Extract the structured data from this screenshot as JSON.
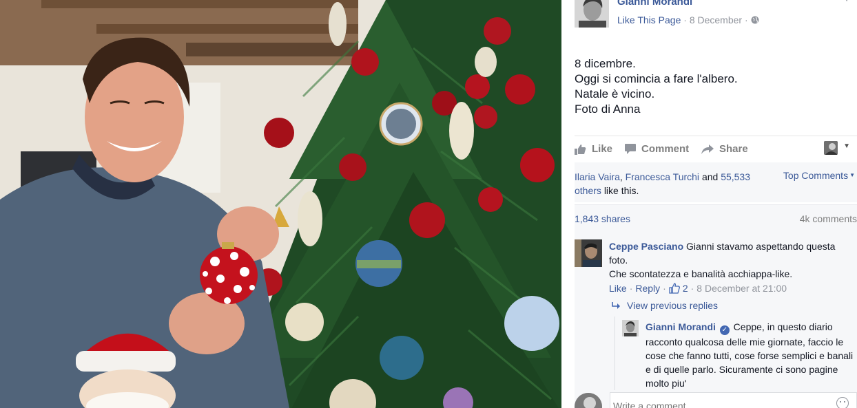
{
  "post": {
    "page_name": "Gianni Morandi",
    "like_page": "Like This Page",
    "separator": "·",
    "date": "8 December",
    "lines": [
      "8 dicembre.",
      "Oggi si comincia a fare l'albero.",
      "Natale è vicino.",
      "Foto di Anna"
    ]
  },
  "actions": {
    "like": "Like",
    "comment": "Comment",
    "share": "Share"
  },
  "likes": {
    "name1": "Ilaria Vaira",
    "comma": ",",
    "name2": "Francesca Turchi",
    "and": "and",
    "others": "55,533 others",
    "suffix": "like this.",
    "top_comments": "Top Comments"
  },
  "stats": {
    "shares": "1,843 shares",
    "comments": "4k comments"
  },
  "comments": [
    {
      "author": "Ceppe Pasciano",
      "text_line1": "Gianni stavamo aspettando questa foto.",
      "text_line2": "Che scontatezza e banalità acchiappa-like.",
      "like": "Like",
      "dot": "·",
      "reply": "Reply",
      "like_count": "2",
      "timestamp": "8 December at 21:00"
    }
  ],
  "view_previous": "View previous replies",
  "reply": {
    "author": "Gianni Morandi",
    "text": "Ceppe, in questo diario racconto qualcosa delle mie giornate, faccio le cose che fanno tutti, cose forse semplici e banali e di quelle parlo. Sicuramente ci sono pagine molto piu'"
  },
  "write_comment": {
    "placeholder": "Write a comment..."
  },
  "icons": {
    "globe": "globe-icon",
    "like": "thumbs-up-icon",
    "comment": "speech-bubble-icon",
    "share": "share-arrow-icon",
    "reply_arrow": "reply-arrow-icon",
    "verified": "verified-badge-icon",
    "smiley": "smiley-icon"
  },
  "colors": {
    "link": "#3b5998",
    "muted": "#90949c",
    "panel": "#f6f7f9"
  }
}
